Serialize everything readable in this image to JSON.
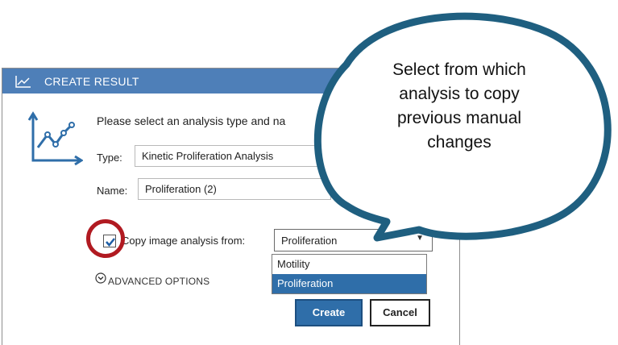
{
  "window": {
    "title": "CREATE RESULT",
    "instruction": "Please select an analysis type and na",
    "type_label": "Type:",
    "type_value": "Kinetic Proliferation Analysis",
    "name_label": "Name:",
    "name_value": "Proliferation (2)",
    "copy_checkbox_checked": true,
    "copy_label": "Copy image analysis from:",
    "copy_selected": "Proliferation",
    "copy_options": [
      "Motility",
      "Proliferation"
    ],
    "advanced_label": "ADVANCED OPTIONS",
    "create_label": "Create",
    "cancel_label": "Cancel"
  },
  "callout": {
    "line1": "Select from which",
    "line2": "analysis to copy",
    "line3": "previous manual",
    "line4": "changes"
  },
  "colors": {
    "titlebar": "#4e7fb8",
    "accent": "#2f6ea9",
    "callout_border": "#1f5f80",
    "highlight_ring": "#b11a21"
  },
  "icons": {
    "titlebar": "line-chart-icon",
    "main": "line-chart-icon",
    "checkbox": "checkmark-icon",
    "dropdown": "caret-down-icon",
    "advanced": "chevron-down-circle-icon"
  }
}
